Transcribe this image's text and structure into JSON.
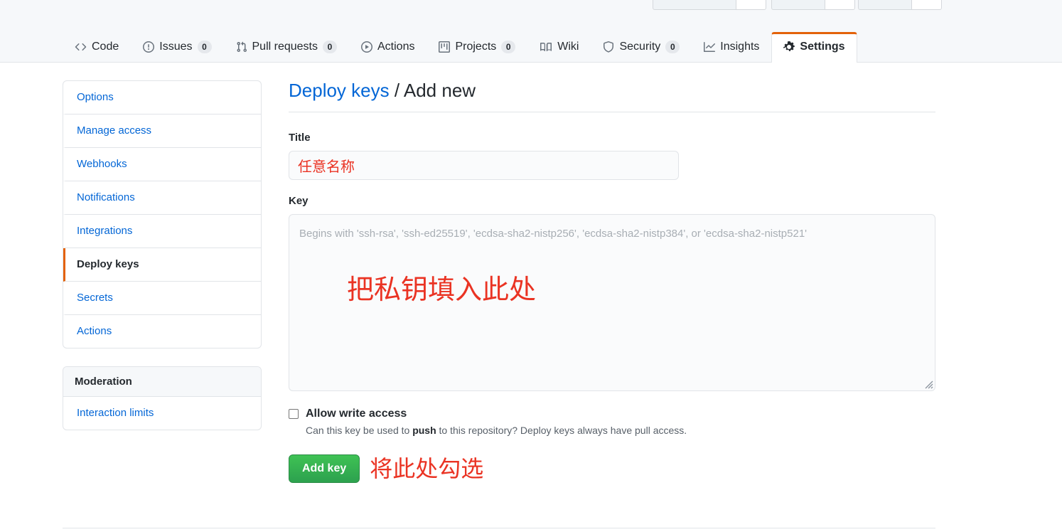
{
  "header": {
    "top_buttons": [
      "watch-button",
      "star-button",
      "fork-button"
    ],
    "nav_items": [
      {
        "icon": "code-icon",
        "label": "Code",
        "count": null,
        "selected": false
      },
      {
        "icon": "issue-icon",
        "label": "Issues",
        "count": "0",
        "selected": false
      },
      {
        "icon": "pull-icon",
        "label": "Pull requests",
        "count": "0",
        "selected": false
      },
      {
        "icon": "actions-icon",
        "label": "Actions",
        "count": null,
        "selected": false
      },
      {
        "icon": "projects-icon",
        "label": "Projects",
        "count": "0",
        "selected": false
      },
      {
        "icon": "wiki-icon",
        "label": "Wiki",
        "count": null,
        "selected": false
      },
      {
        "icon": "shield-icon",
        "label": "Security",
        "count": "0",
        "selected": false
      },
      {
        "icon": "insights-icon",
        "label": "Insights",
        "count": null,
        "selected": false
      },
      {
        "icon": "gear-icon",
        "label": "Settings",
        "count": null,
        "selected": true
      }
    ]
  },
  "sidebar": {
    "groups": [
      {
        "heading": null,
        "items": [
          {
            "label": "Options",
            "selected": false
          },
          {
            "label": "Manage access",
            "selected": false
          },
          {
            "label": "Webhooks",
            "selected": false
          },
          {
            "label": "Notifications",
            "selected": false
          },
          {
            "label": "Integrations",
            "selected": false
          },
          {
            "label": "Deploy keys",
            "selected": true
          },
          {
            "label": "Secrets",
            "selected": false
          },
          {
            "label": "Actions",
            "selected": false
          }
        ]
      },
      {
        "heading": "Moderation",
        "items": [
          {
            "label": "Interaction limits",
            "selected": false
          }
        ]
      }
    ]
  },
  "main": {
    "breadcrumb_link": "Deploy keys",
    "breadcrumb_separator": " / ",
    "breadcrumb_current": "Add new",
    "title_field": {
      "label": "Title",
      "value": "任意名称",
      "placeholder": ""
    },
    "key_field": {
      "label": "Key",
      "value": "",
      "placeholder": "Begins with 'ssh-rsa', 'ssh-ed25519', 'ecdsa-sha2-nistp256', 'ecdsa-sha2-nistp384', or 'ecdsa-sha2-nistp521'",
      "annotation": "把私钥填入此处"
    },
    "write_access": {
      "label": "Allow write access",
      "checked": false,
      "note_before": "Can this key be used to ",
      "note_bold": "push",
      "note_after": " to this repository? Deploy keys always have pull access."
    },
    "submit": {
      "label": "Add key",
      "annotation": "将此处勾选"
    }
  },
  "colors": {
    "accent_orange": "#e36209",
    "link_blue": "#0366d6",
    "annotation_red": "#ea3323",
    "button_green": "#2ea44f",
    "header_bg": "#f6f8fa",
    "border": "#e1e4e8"
  }
}
